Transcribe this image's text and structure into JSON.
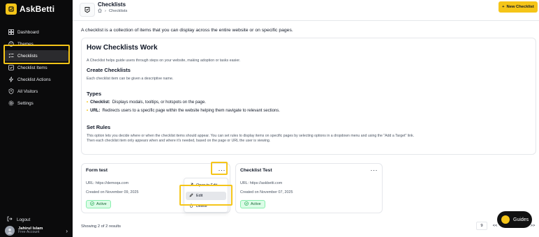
{
  "brand": {
    "name": "AskBetti"
  },
  "sidebar": {
    "items": [
      {
        "label": "Dashboard",
        "icon": "grid-icon"
      },
      {
        "label": "Themes",
        "icon": "palette-icon"
      },
      {
        "label": "Checklists",
        "icon": "checklist-icon",
        "active": true
      },
      {
        "label": "Checklist Items",
        "icon": "check-square-icon"
      },
      {
        "label": "Checklist Actions",
        "icon": "lightning-icon"
      },
      {
        "label": "All Visitors",
        "icon": "shield-user-icon"
      },
      {
        "label": "Settings",
        "icon": "gear-icon"
      }
    ],
    "logout": "Logout",
    "user": {
      "name": "Jahirul Islam",
      "plan": "Free Account"
    }
  },
  "header": {
    "title": "Checklists",
    "breadcrumb": "Checklists",
    "new_button": "New Checklist"
  },
  "intro": "A checklist is a collection of items that you can display across the entire website or on specific pages.",
  "how": {
    "title": "How Checklists Work",
    "lead": "A Checklist helps guide users through steps on your website, making adoption or tasks easier.",
    "create_title": "Create Checklists",
    "create_text": "Each checklist item can be given a descriptive name.",
    "types_title": "Types",
    "types": [
      {
        "name": "Checklist:",
        "text": "Displays modals, tooltips, or hotspots on the page."
      },
      {
        "name": "URL:",
        "text": "Redirects users to a specific page within the website helping them navigate to relevant sections."
      }
    ],
    "rules_title": "Set Rules",
    "rules_line1": "This option lets you decide where or when the checklist items should appear. You can set rules to display items on specific pages by selecting options in a dropdown menu and using the \"Add a Target\" link.",
    "rules_line2": "Then each checklist item only appears when and where it's needed, based on the page or URL the user is viewing."
  },
  "cards": [
    {
      "title": "Form test",
      "url": "URL: https://demoqa.com",
      "date": "Created on November 09, 2025",
      "status": "Active"
    },
    {
      "title": "Checklist Test",
      "url": "URL: https://askbetti.com",
      "date": "Created on November 07, 2025",
      "status": "Active"
    }
  ],
  "menu": {
    "open": "Open to Edit",
    "edit": "Edit",
    "delete": "Delete"
  },
  "footer": {
    "showing": "Showing 2 of 2 results",
    "page_size": "9",
    "first": "<<",
    "prev": "<",
    "next": ">",
    "last": ">>"
  },
  "guides": {
    "label": "Guides"
  },
  "colors": {
    "accent": "#f5c518",
    "sidebar_bg": "#0b0b0c",
    "active_badge": "#dcfce7"
  }
}
